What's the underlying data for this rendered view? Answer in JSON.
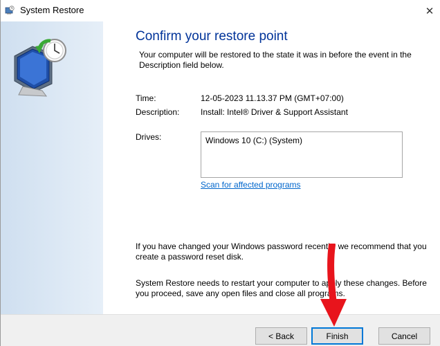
{
  "window": {
    "title": "System Restore",
    "close_glyph": "✕"
  },
  "content": {
    "heading": "Confirm your restore point",
    "intro": "Your computer will be restored to the state it was in before the event in the Description field below.",
    "time_label": "Time:",
    "time_value": "12-05-2023 11.13.37 PM (GMT+07:00)",
    "description_label": "Description:",
    "description_value": "Install: Intel® Driver & Support Assistant",
    "drives_label": "Drives:",
    "drives": [
      "Windows 10 (C:) (System)"
    ],
    "scan_link": "Scan for affected programs",
    "password_note": "If you have changed your Windows password recently, we recommend that you create a password reset disk.",
    "restart_note": "System Restore needs to restart your computer to apply these changes. Before you proceed, save any open files and close all programs."
  },
  "footer": {
    "back_label": "< Back",
    "finish_label": "Finish",
    "cancel_label": "Cancel"
  },
  "colors": {
    "heading": "#003399",
    "link": "#0066cc",
    "arrow": "#e8141c",
    "default_button_border": "#0078d7"
  },
  "icons": {
    "title": "system-restore-icon",
    "side": "computer-clock-restore-icon",
    "close": "close-icon",
    "annotation": "red-arrow-pointer"
  }
}
